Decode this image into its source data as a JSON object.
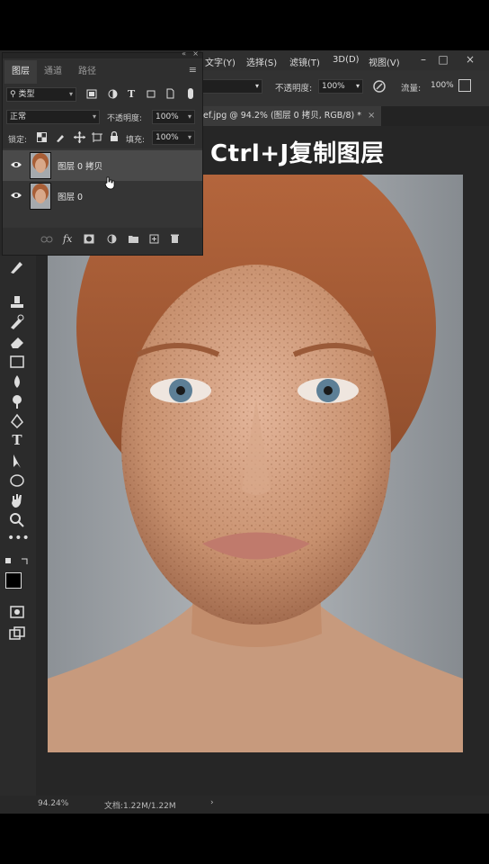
{
  "caption": "Ctrl+J复制图层",
  "menu": {
    "items": [
      "文字(Y)",
      "选择(S)",
      "滤镜(T)",
      "3D(D)",
      "视图(V)"
    ]
  },
  "options": {
    "opacity_label": "不透明度:",
    "opacity_value": "100%",
    "flow_label": "流量:",
    "flow_value": "100%"
  },
  "document_tab": {
    "title": "ef.jpg @ 94.2% (图层 0 拷贝, RGB/8) *",
    "close": "×"
  },
  "layers_panel": {
    "tabs": [
      "图层",
      "通道",
      "路径"
    ],
    "filter_label": "类型",
    "blend_mode": "正常",
    "opacity_label": "不透明度:",
    "opacity_value": "100%",
    "lock_label": "锁定:",
    "fill_label": "填充:",
    "fill_value": "100%",
    "layers": [
      {
        "name": "图层 0 拷贝",
        "visible": true,
        "selected": true
      },
      {
        "name": "图层 0",
        "visible": true,
        "selected": false
      }
    ],
    "footer_icons": [
      "link-icon",
      "fx-icon",
      "mask-icon",
      "adjustment-icon",
      "folder-icon",
      "new-layer-icon",
      "trash-icon"
    ],
    "fx_label": "fx"
  },
  "toolbox": {
    "tools": [
      "brush-icon",
      "stamp-icon",
      "history-brush-icon",
      "eraser-icon",
      "gradient-icon",
      "blur-icon",
      "dodge-icon",
      "pen-icon",
      "type-icon",
      "path-select-icon",
      "ellipse-icon",
      "hand-icon",
      "zoom-icon",
      "more-icon"
    ],
    "type_glyph": "T"
  },
  "status": {
    "zoom": "94.24%",
    "doc_info": "文档:1.22M/1.22M",
    "arrow": "›"
  },
  "colors": {
    "panel_bg": "#2f2f2f",
    "selected_row": "#4a4a4a",
    "canvas_bg": "#262626"
  }
}
